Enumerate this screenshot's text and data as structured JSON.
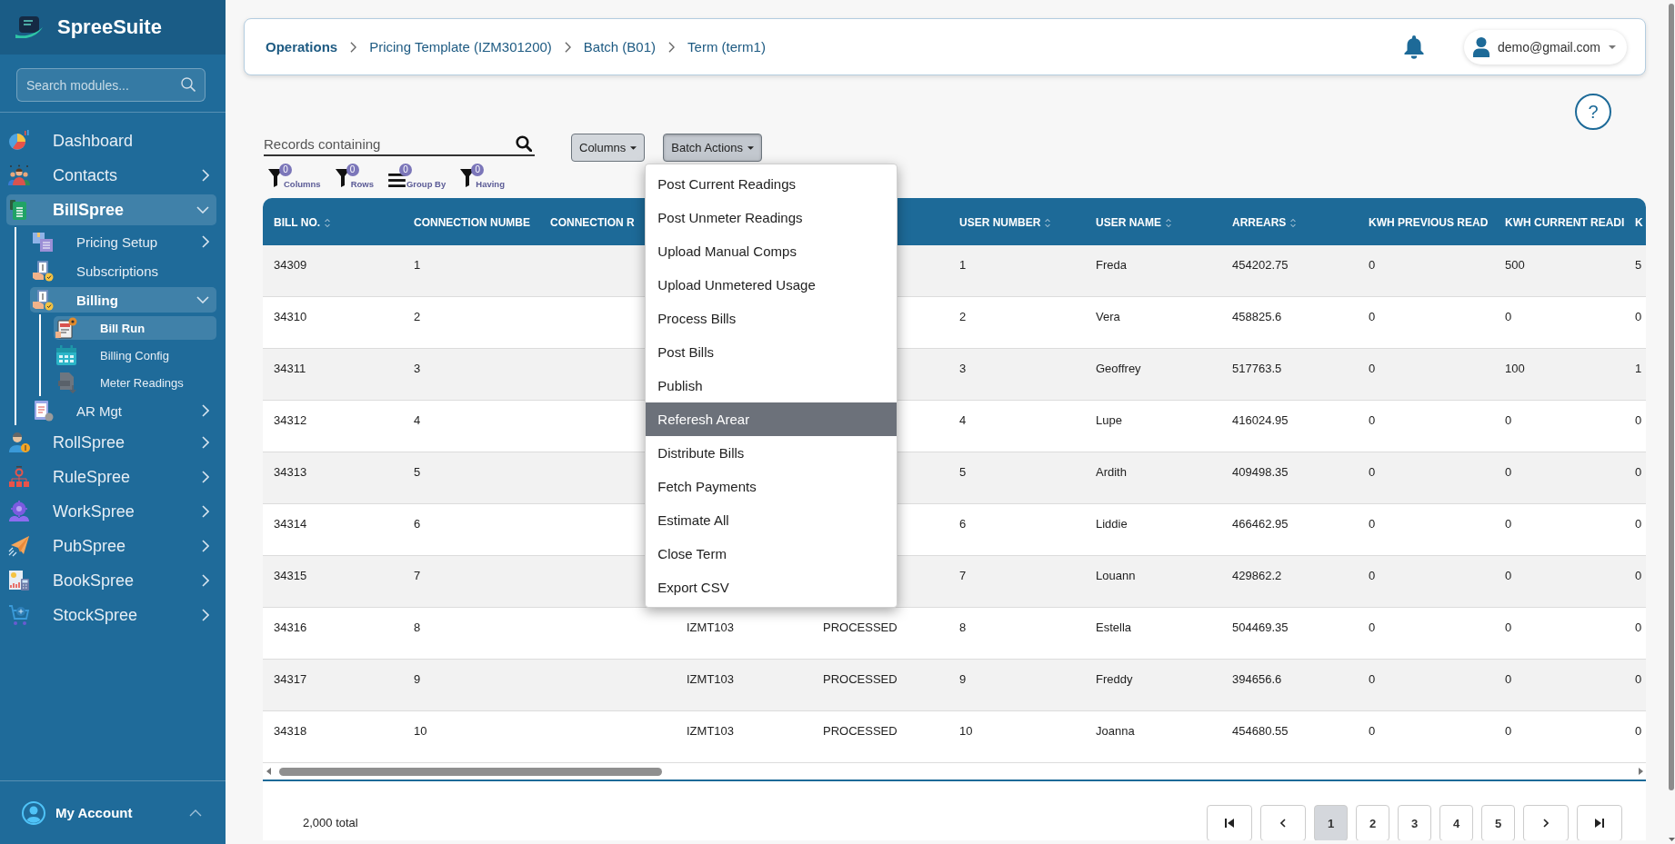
{
  "sidebar": {
    "brand": "SpreeSuite",
    "search": {
      "placeholder": "Search modules..."
    },
    "items": [
      {
        "label": "Dashboard",
        "selected": false
      },
      {
        "label": "Contacts",
        "selected": false,
        "expanded": false
      },
      {
        "label": "BillSpree",
        "selected": true,
        "expanded": true,
        "children": [
          {
            "label": "Pricing Setup",
            "selected": false,
            "expanded": false
          },
          {
            "label": "Subscriptions",
            "selected": false
          },
          {
            "label": "Billing",
            "selected": true,
            "expanded": true,
            "children": [
              {
                "label": "Bill Run",
                "selected": true
              },
              {
                "label": "Billing Config",
                "selected": false
              },
              {
                "label": "Meter Readings",
                "selected": false
              }
            ]
          },
          {
            "label": "AR Mgt",
            "selected": false,
            "expanded": false
          }
        ]
      },
      {
        "label": "RollSpree",
        "selected": false,
        "expanded": false
      },
      {
        "label": "RuleSpree",
        "selected": false,
        "expanded": false
      },
      {
        "label": "WorkSpree",
        "selected": false,
        "expanded": false
      },
      {
        "label": "PubSpree",
        "selected": false,
        "expanded": false
      },
      {
        "label": "BookSpree",
        "selected": false,
        "expanded": false
      },
      {
        "label": "StockSpree",
        "selected": false,
        "expanded": false
      }
    ],
    "account": {
      "label": "My Account",
      "expanded": false
    }
  },
  "header": {
    "breadcrumbs": [
      "Operations",
      "Pricing Template (IZM301200)",
      "Batch (B01)",
      "Term (term1)"
    ],
    "user": {
      "email": "demo@gmail.com"
    }
  },
  "help": {
    "label": "?"
  },
  "toolbar": {
    "search": {
      "placeholder": "Records containing"
    },
    "buttons": [
      {
        "label": "Columns",
        "expanded": false
      },
      {
        "label": "Batch Actions",
        "expanded": true,
        "menu": [
          {
            "label": "Post Current Readings",
            "selected": false
          },
          {
            "label": "Post Unmeter Readings",
            "selected": false
          },
          {
            "label": "Upload Manual Comps",
            "selected": false
          },
          {
            "label": "Upload Unmetered Usage",
            "selected": false
          },
          {
            "label": "Process Bills",
            "selected": false
          },
          {
            "label": "Post Bills",
            "selected": false
          },
          {
            "label": "Publish",
            "selected": false
          },
          {
            "label": "Referesh Arear",
            "selected": true
          },
          {
            "label": "Distribute Bills",
            "selected": false
          },
          {
            "label": "Fetch Payments",
            "selected": false
          },
          {
            "label": "Estimate All",
            "selected": false
          },
          {
            "label": "Close Term",
            "selected": false
          },
          {
            "label": "Export CSV",
            "selected": false
          }
        ]
      }
    ],
    "filters": [
      {
        "kind": "filter",
        "label": "Columns",
        "count": "0"
      },
      {
        "kind": "filter",
        "label": "Rows",
        "count": "0"
      },
      {
        "kind": "group",
        "label": "Group By",
        "count": "0"
      },
      {
        "kind": "filter",
        "label": "Having",
        "count": "0"
      }
    ]
  },
  "table": {
    "columns": [
      {
        "label": "BILL NO.",
        "sortable": true
      },
      {
        "label": "CONNECTION NUMBE",
        "sortable": false
      },
      {
        "label": "CONNECTION R",
        "sortable": false
      },
      null,
      null,
      {
        "label": "USER NUMBER",
        "sortable": true
      },
      {
        "label": "USER NAME",
        "sortable": true
      },
      {
        "label": "ARREARS",
        "sortable": true
      },
      {
        "label": "KWH PREVIOUS READ",
        "sortable": false
      },
      {
        "label": "KWH CURRENT READI",
        "sortable": false
      },
      {
        "label": "K",
        "sortable": false
      }
    ],
    "rows": [
      {
        "cells": [
          "34309",
          "1",
          null,
          null,
          null,
          "1",
          "Freda",
          "454202.75",
          "0",
          "500",
          "5"
        ]
      },
      {
        "cells": [
          "34310",
          "2",
          null,
          null,
          null,
          "2",
          "Vera",
          "458825.6",
          "0",
          "0",
          "0"
        ]
      },
      {
        "cells": [
          "34311",
          "3",
          null,
          null,
          null,
          "3",
          "Geoffrey",
          "517763.5",
          "0",
          "100",
          "1"
        ]
      },
      {
        "cells": [
          "34312",
          "4",
          null,
          null,
          null,
          "4",
          "Lupe",
          "416024.95",
          "0",
          "0",
          "0"
        ]
      },
      {
        "cells": [
          "34313",
          "5",
          null,
          null,
          null,
          "5",
          "Ardith",
          "409498.35",
          "0",
          "0",
          "0"
        ]
      },
      {
        "cells": [
          "34314",
          "6",
          null,
          null,
          null,
          "6",
          "Liddie",
          "466462.95",
          "0",
          "0",
          "0"
        ]
      },
      {
        "cells": [
          "34315",
          "7",
          null,
          null,
          null,
          "7",
          "Louann",
          "429862.2",
          "0",
          "0",
          "0"
        ]
      },
      {
        "cells": [
          "34316",
          "8",
          null,
          "IZMT103",
          "PROCESSED",
          "8",
          "Estella",
          "504469.35",
          "0",
          "0",
          "0"
        ]
      },
      {
        "cells": [
          "34317",
          "9",
          null,
          "IZMT103",
          "PROCESSED",
          "9",
          "Freddy",
          "394656.6",
          "0",
          "0",
          "0"
        ]
      },
      {
        "cells": [
          "34318",
          "10",
          null,
          "IZMT103",
          "PROCESSED",
          "10",
          "Joanna",
          "454680.55",
          "0",
          "0",
          "0"
        ]
      }
    ]
  },
  "pagination": {
    "total": "2,000 total",
    "pages": [
      {
        "label": "1",
        "selected": true
      },
      {
        "label": "2",
        "selected": false
      },
      {
        "label": "3",
        "selected": false
      },
      {
        "label": "4",
        "selected": false
      },
      {
        "label": "5",
        "selected": false
      }
    ]
  }
}
